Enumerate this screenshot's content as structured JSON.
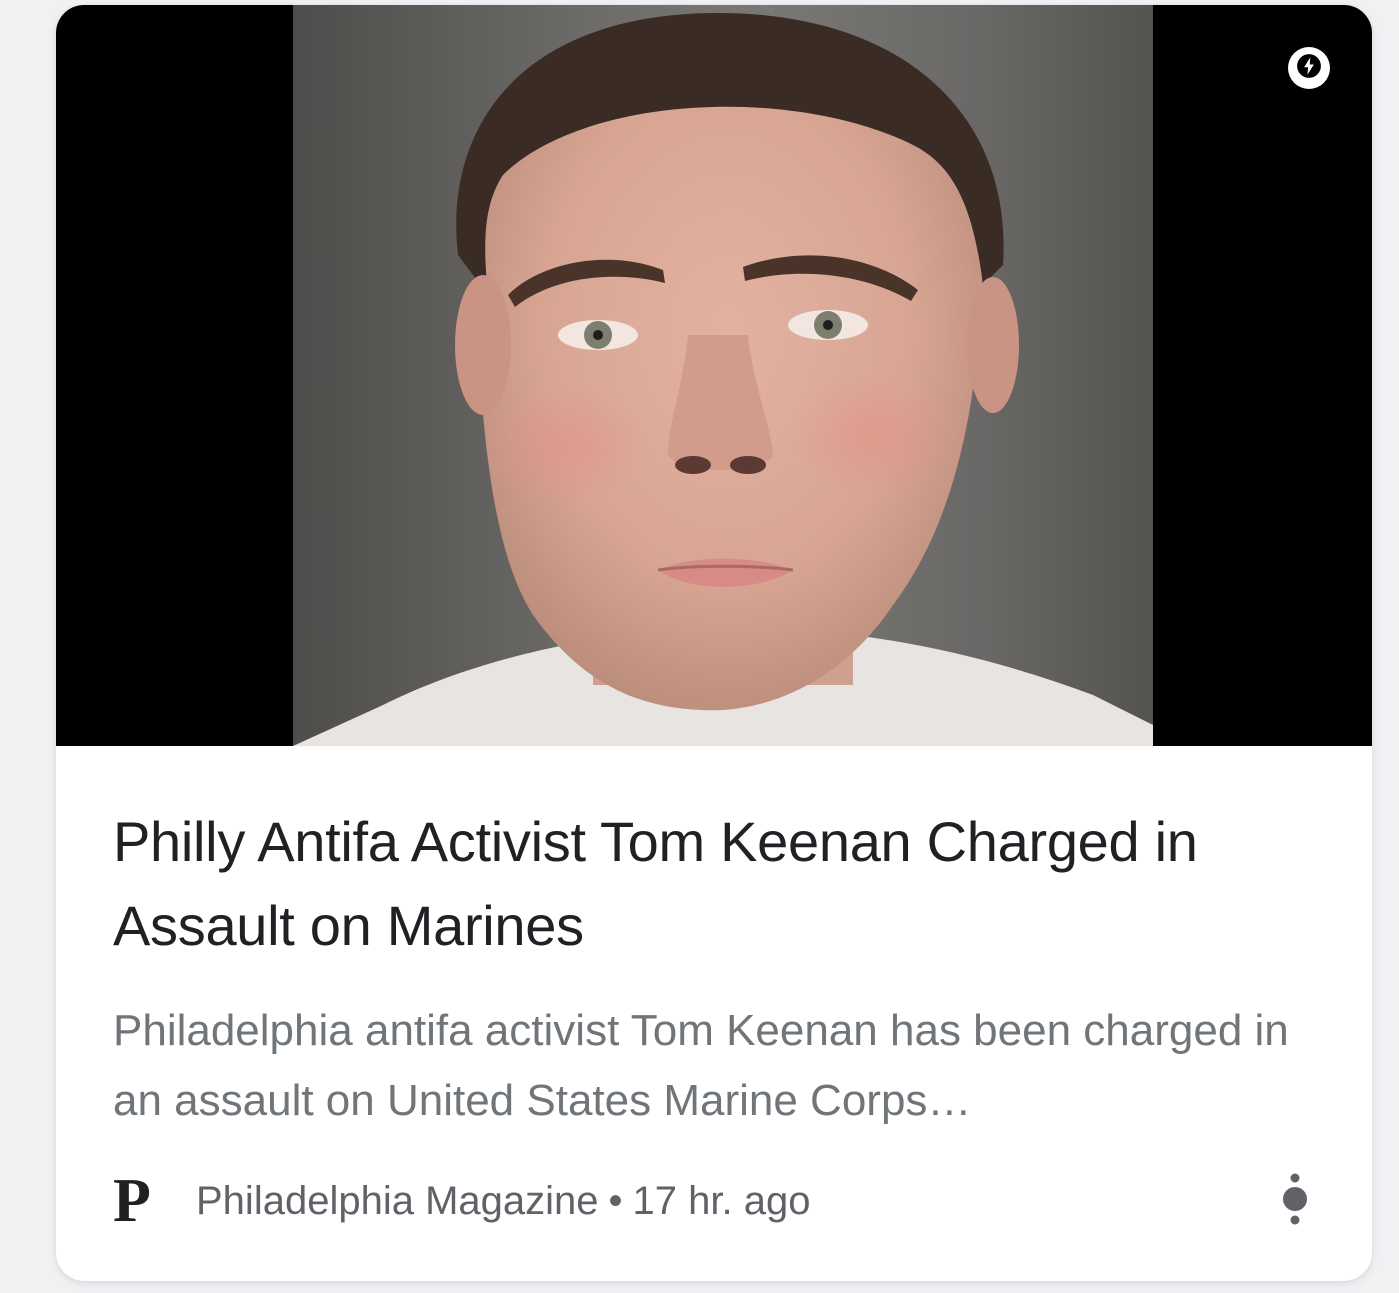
{
  "article": {
    "headline": "Philly Antifa Activist Tom Keenan Charged in Assault on Marines",
    "snippet": "Philadelphia antifa activist Tom Keenan has been charged in an assault on United States Marine Corps…",
    "publisher": {
      "logo_letter": "P",
      "name": "Philadelphia Magazine"
    },
    "separator": "•",
    "time": "17 hr. ago"
  },
  "icons": {
    "amp": "lightning-bolt-icon",
    "more": "more-vert-icon"
  },
  "colors": {
    "headline": "#202124",
    "snippet": "#70757a",
    "meta": "#5f6368",
    "image_letterbox": "#000000"
  }
}
